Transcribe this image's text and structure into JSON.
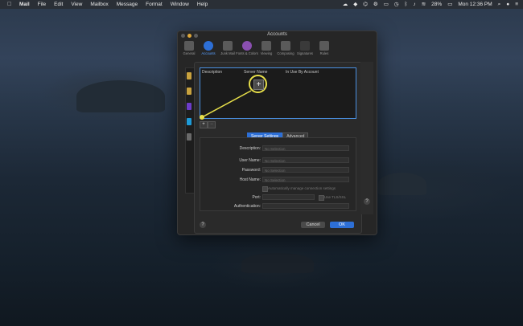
{
  "menubar": {
    "app": "Mail",
    "items": [
      "File",
      "Edit",
      "View",
      "Mailbox",
      "Message",
      "Format",
      "Window",
      "Help"
    ],
    "battery": "28%",
    "clock": "Mon 12:36 PM"
  },
  "window": {
    "title": "Accounts",
    "toolbar": [
      "General",
      "Accounts",
      "Junk Mail",
      "Fonts & Colors",
      "Viewing",
      "Composing",
      "Signatures",
      "Rules"
    ]
  },
  "sheet": {
    "columns": [
      "Description",
      "Server Name",
      "In Use By Account"
    ],
    "add_label": "+",
    "remove_label": "−",
    "tabs": [
      "Server Settings",
      "Advanced"
    ],
    "fields": {
      "description_label": "Description:",
      "username_label": "User Name:",
      "password_label": "Password:",
      "host_label": "Host Name:",
      "port_label": "Port:",
      "auth_label": "Authentication:",
      "placeholder": "No Selection"
    },
    "auto_manage": "Automatically manage connection settings",
    "use_tls": "Use TLS/SSL",
    "cancel": "Cancel",
    "ok": "OK",
    "help": "?"
  },
  "colors": {
    "accent": "#2d6fd6",
    "highlight": "#e8e04a"
  }
}
